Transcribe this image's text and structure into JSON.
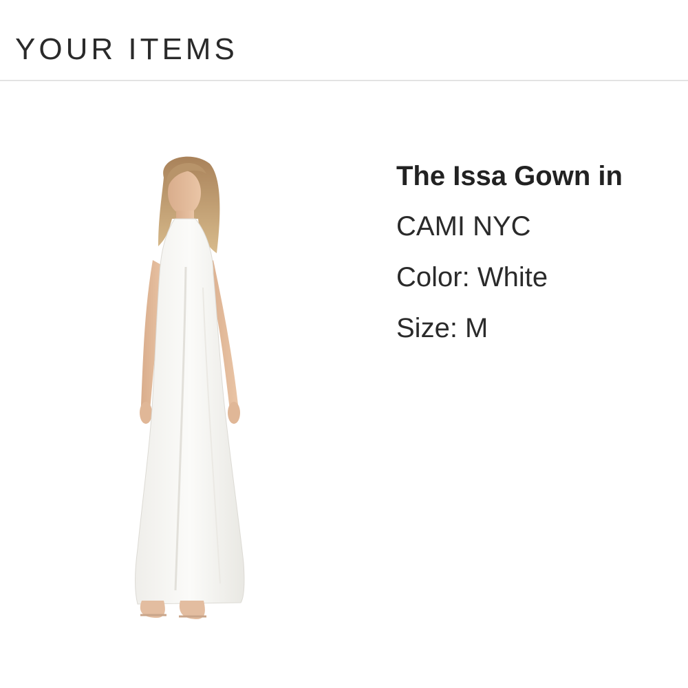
{
  "section": {
    "title": "YOUR ITEMS"
  },
  "item": {
    "image_alt": "The Issa Gown in White",
    "name": "The Issa Gown in",
    "brand": "CAMI NYC",
    "color_text": "Color: White",
    "size_text": "Size: M"
  }
}
